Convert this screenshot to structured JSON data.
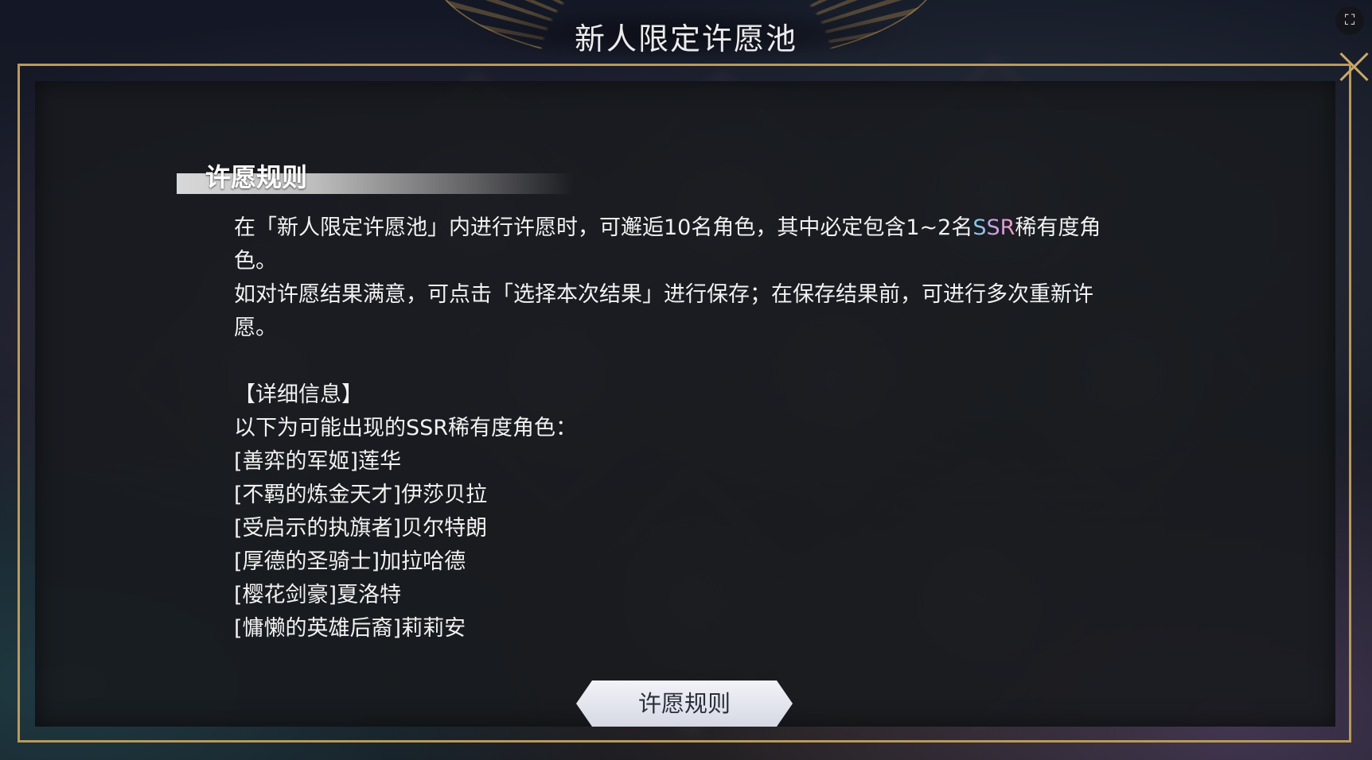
{
  "window": {
    "title": "新人限定许愿池"
  },
  "icons": {
    "close": "close-icon",
    "screenshot": "screenshot-icon"
  },
  "section": {
    "title": "许愿规则"
  },
  "rules": {
    "paragraph1_before": "在「新人限定许愿池」内进行许愿时，可邂逅10名角色，其中必定包含1~2名",
    "paragraph1_highlight": "SSR",
    "paragraph1_after": "稀有度角色。",
    "paragraph2": "如对许愿结果满意，可点击「选择本次结果」进行保存；在保存结果前，可进行多次重新许愿。",
    "detail_header": "【详细信息】",
    "detail_intro": "以下为可能出现的SSR稀有度角色：",
    "characters": [
      "[善弈的军姬]莲华",
      "[不羁的炼金天才]伊莎贝拉",
      "[受启示的执旗者]贝尔特朗",
      "[厚德的圣骑士]加拉哈德",
      "[樱花剑豪]夏洛特",
      "[慵懒的英雄后裔]莉莉安"
    ]
  },
  "bottom_tab": {
    "label": "许愿规则"
  },
  "colors": {
    "frame_gold": "#b99a5c",
    "ssr_gradient_start": "#6fd6e8",
    "ssr_gradient_end": "#f29ac4",
    "text": "#f2f2f2"
  }
}
